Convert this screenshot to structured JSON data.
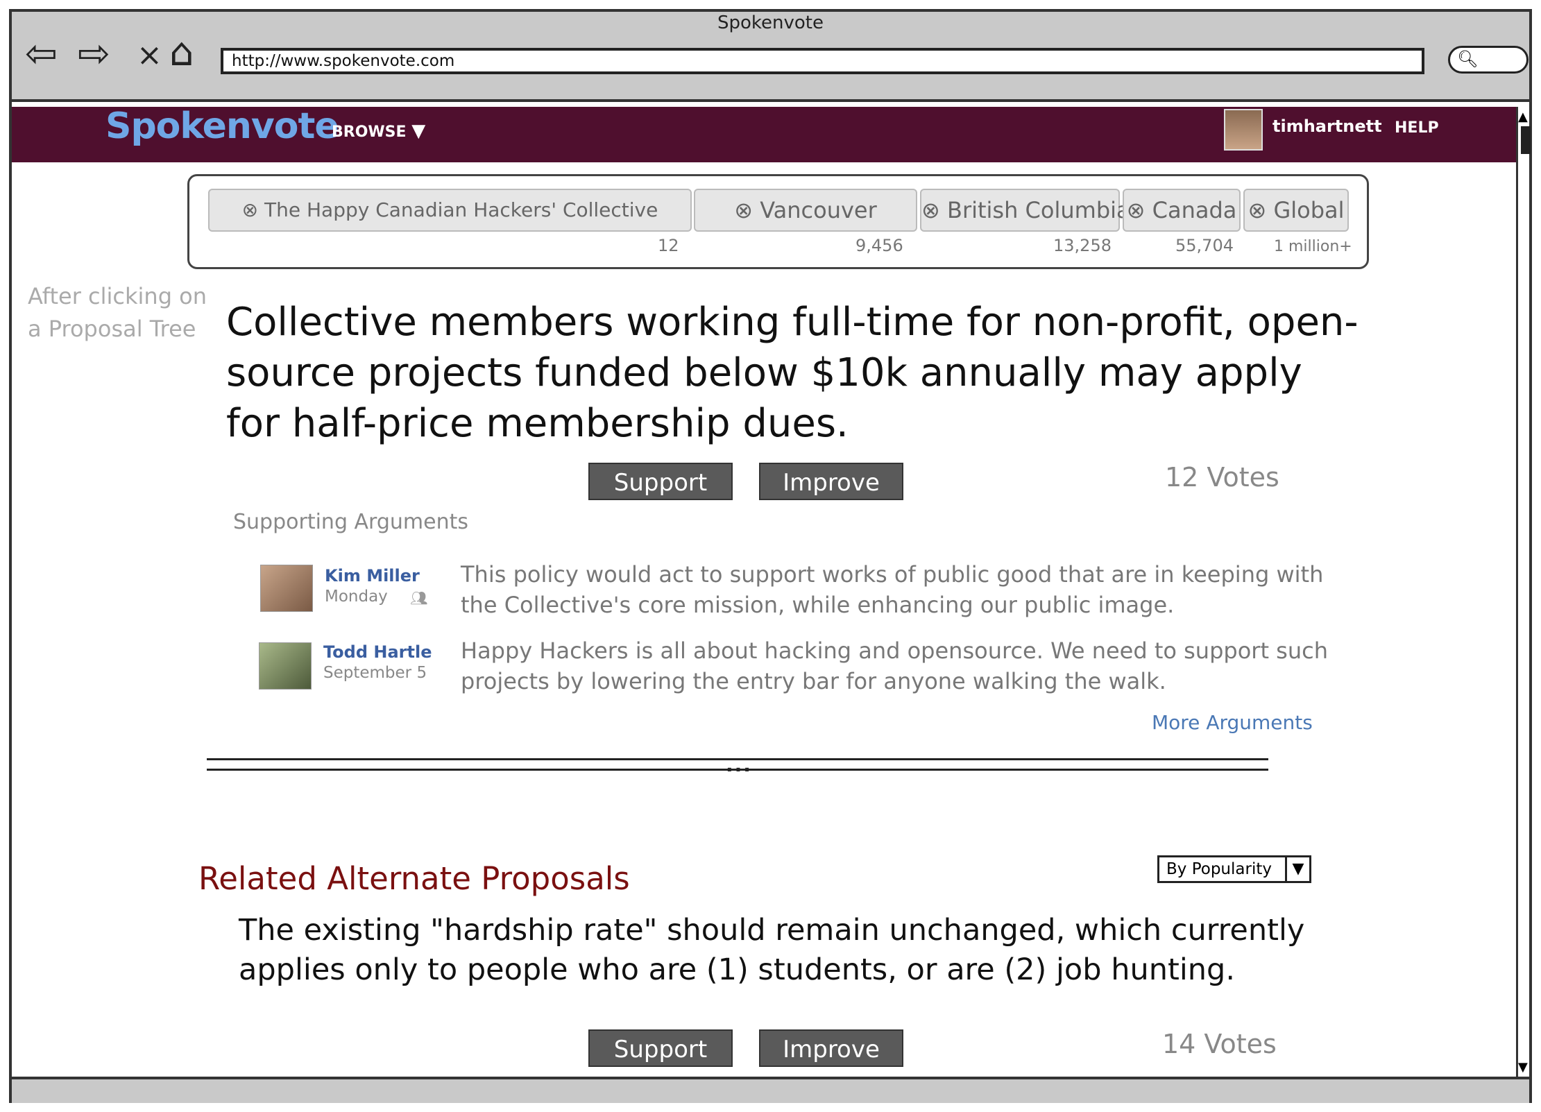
{
  "window": {
    "title": "Spokenvote",
    "url": "http://www.spokenvote.com"
  },
  "nav_icons": {
    "back": "back-arrow-icon",
    "forward": "forward-arrow-icon",
    "stop": "close-icon",
    "home": "home-icon",
    "search": "search-icon"
  },
  "header": {
    "logo": "Spokenvote",
    "browse": "BROWSE",
    "username": "timhartnett",
    "help": "HELP"
  },
  "scopes": [
    {
      "label": "The Happy Canadian Hackers' Collective",
      "count": "12"
    },
    {
      "label": "Vancouver",
      "count": "9,456"
    },
    {
      "label": "British Columbia",
      "count": "13,258"
    },
    {
      "label": "Canada",
      "count": "55,704"
    },
    {
      "label": "Global",
      "count": "1 million+"
    }
  ],
  "side_note": {
    "line1": "After clicking on",
    "line2": "a Proposal Tree"
  },
  "proposal": {
    "title": "Collective members working full-time for non-profit, open-source projects funded below $10k annually may apply for half-price membership dues.",
    "support_label": "Support",
    "improve_label": "Improve",
    "votes": "12 Votes"
  },
  "supporting": {
    "label": "Supporting Arguments",
    "arguments": [
      {
        "name": "Kim Miller",
        "date": "Monday",
        "text": "This policy would act to support works of public good that are in keeping with the Collective's core mission, while enhancing our public image."
      },
      {
        "name": "Todd Hartle",
        "date": "September 5",
        "text": "Happy Hackers is all about hacking and opensource. We need to support such projects by lowering the entry bar for anyone walking the walk."
      }
    ],
    "more": "More Arguments"
  },
  "divider": "...",
  "related": {
    "heading": "Related Alternate Proposals",
    "sort": "By Popularity",
    "proposal_text": "The existing \"hardship rate\" should remain unchanged, which currently applies only to people who are (1) students, or are (2) job hunting.",
    "support_label": "Support",
    "improve_label": "Improve",
    "votes": "14 Votes"
  },
  "colors": {
    "header_bg": "#4f0f2e",
    "logo": "#6fa7e6",
    "related_heading": "#7a1010",
    "link": "#4a78b5"
  }
}
